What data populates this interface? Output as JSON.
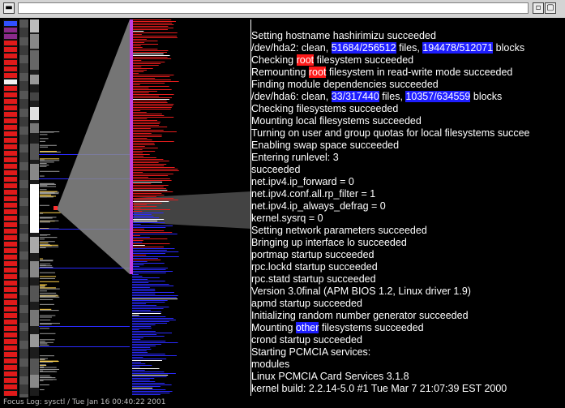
{
  "window": {
    "title": "",
    "menu_icon": "window-menu-icon",
    "buttons": [
      {
        "name": "minimize-icon",
        "glyph": "▫"
      },
      {
        "name": "maximize-icon",
        "glyph": "▢"
      },
      {
        "name": "close-icon",
        "glyph": "✕"
      }
    ]
  },
  "colors": {
    "background": "#000000",
    "red_highlight": "#ff1a1a",
    "blue_highlight": "#1e1eff",
    "magenta_marker": "#c040e0",
    "focus_lens": "#808080"
  },
  "log_lines": [
    [
      {
        "t": "Setting hostname hashirimizu succeeded"
      }
    ],
    [
      {
        "t": "/dev/hda2: clean, "
      },
      {
        "t": "51684/256512",
        "hl": "blue"
      },
      {
        "t": " files, "
      },
      {
        "t": "194478/512071",
        "hl": "blue"
      },
      {
        "t": " blocks"
      }
    ],
    [
      {
        "t": "Checking "
      },
      {
        "t": "root",
        "hl": "red"
      },
      {
        "t": " filesystem succeeded"
      }
    ],
    [
      {
        "t": "Remounting "
      },
      {
        "t": "root",
        "hl": "red"
      },
      {
        "t": " filesystem in read-write mode succeeded"
      }
    ],
    [
      {
        "t": "Finding module dependencies succeeded"
      }
    ],
    [
      {
        "t": "/dev/hda6: clean, "
      },
      {
        "t": "33/317440",
        "hl": "blue"
      },
      {
        "t": " files, "
      },
      {
        "t": "10357/634559",
        "hl": "blue"
      },
      {
        "t": " blocks"
      }
    ],
    [
      {
        "t": "Checking filesystems succeeded"
      }
    ],
    [
      {
        "t": "Mounting local filesystems succeeded"
      }
    ],
    [
      {
        "t": "Turning on user and group quotas for local filesystems succee"
      }
    ],
    [
      {
        "t": "Enabling swap space succeeded"
      }
    ],
    [
      {
        "t": "Entering runlevel: 3"
      }
    ],
    [
      {
        "t": "succeeded"
      }
    ],
    [
      {
        "t": "net.ipv4.ip_forward = 0"
      }
    ],
    [
      {
        "t": "net.ipv4.conf.all.rp_filter = 1"
      }
    ],
    [
      {
        "t": "net.ipv4.ip_always_defrag = 0"
      }
    ],
    [
      {
        "t": "kernel.sysrq = 0"
      }
    ],
    [
      {
        "t": "Setting network parameters succeeded"
      }
    ],
    [
      {
        "t": "Bringing up interface lo succeeded"
      }
    ],
    [
      {
        "t": "portmap startup succeeded"
      }
    ],
    [
      {
        "t": "rpc.lockd startup succeeded"
      }
    ],
    [
      {
        "t": "rpc.statd startup succeeded"
      }
    ],
    [
      {
        "t": "Version 3.0final (APM BIOS 1.2, Linux driver 1.9)"
      }
    ],
    [
      {
        "t": "apmd startup succeeded"
      }
    ],
    [
      {
        "t": "Initializing random number generator succeeded"
      }
    ],
    [
      {
        "t": "Mounting "
      },
      {
        "t": "other",
        "hl": "blue"
      },
      {
        "t": " filesystems succeeded"
      }
    ],
    [
      {
        "t": "crond startup succeeded"
      }
    ],
    [
      {
        "t": "Starting PCMCIA services:"
      }
    ],
    [
      {
        "t": "modules"
      }
    ],
    [
      {
        "t": "Linux PCMCIA Card Services 3.1.8"
      }
    ],
    [
      {
        "t": "kernel build: 2.2.14-5.0 #1 Tue Mar 7 21:07:39 EST 2000"
      }
    ]
  ],
  "status": {
    "text": "Focus Log: sysctl / Tue Jan 16 00:40:22 2001"
  }
}
